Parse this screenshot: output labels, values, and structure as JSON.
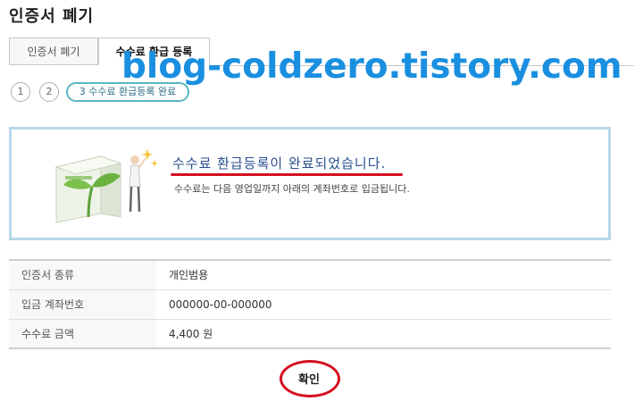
{
  "page": {
    "title": "인증서 폐기"
  },
  "tabs": [
    {
      "label": "인증서 폐기"
    },
    {
      "label": "수수료 환급 등록"
    }
  ],
  "watermark": "blog-coldzero.tistory.com",
  "steps": [
    {
      "label": "1"
    },
    {
      "label": "2"
    },
    {
      "label": "3 수수료 환급등록 완료"
    }
  ],
  "result": {
    "title": "수수료 환급등록이 완료되었습니다.",
    "description": "수수료는 다음 영업일까지 아래의 계좌번호로 입금됩니다."
  },
  "info": {
    "rows": [
      {
        "label": "인증서 종류",
        "value": "개인범용"
      },
      {
        "label": "입금 계좌번호",
        "value": "000000-00-000000"
      },
      {
        "label": "수수료 금액",
        "value": "4,400 원"
      }
    ]
  },
  "actions": {
    "confirm_label": "확인"
  },
  "colors": {
    "accent": "#2a4f8f",
    "annotation_red": "#d40f1f",
    "watermark": "#1a8fe0",
    "box_border": "#b7d7e9"
  }
}
